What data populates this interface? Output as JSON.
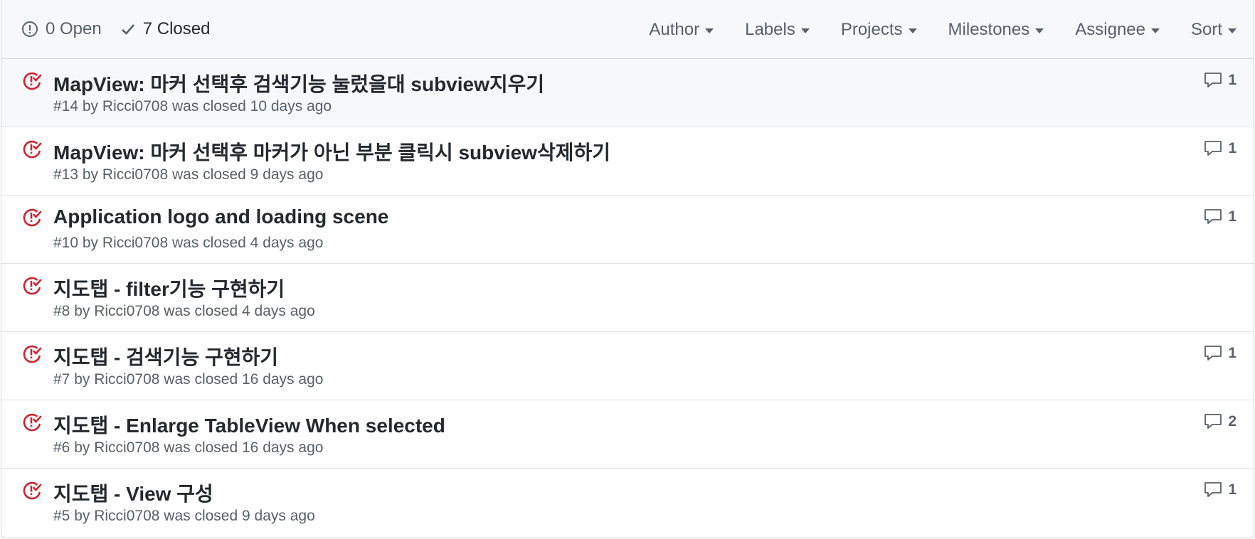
{
  "header": {
    "open_label": "0 Open",
    "closed_label": "7 Closed",
    "filters": [
      "Author",
      "Labels",
      "Projects",
      "Milestones",
      "Assignee",
      "Sort"
    ]
  },
  "colors": {
    "closed_icon": "#cb2431",
    "header_bg": "#f6f8fa",
    "muted_text": "#586069"
  },
  "issues": [
    {
      "title": "MapView: 마커 선택후 검색기능 눌렀을대 subview지우기",
      "number": "#14",
      "author": "Ricci0708",
      "closed_text": "was closed 10 days ago",
      "comments": "1"
    },
    {
      "title": "MapView: 마커 선택후 마커가 아닌 부분 클릭시 subview삭제하기",
      "number": "#13",
      "author": "Ricci0708",
      "closed_text": "was closed 9 days ago",
      "comments": "1"
    },
    {
      "title": "Application logo and loading scene",
      "number": "#10",
      "author": "Ricci0708",
      "closed_text": "was closed 4 days ago",
      "comments": "1"
    },
    {
      "title": "지도탭 - filter기능 구현하기",
      "number": "#8",
      "author": "Ricci0708",
      "closed_text": "was closed 4 days ago",
      "comments": ""
    },
    {
      "title": "지도탭 - 검색기능 구현하기",
      "number": "#7",
      "author": "Ricci0708",
      "closed_text": "was closed 16 days ago",
      "comments": "1"
    },
    {
      "title": "지도탭 - Enlarge TableView When selected",
      "number": "#6",
      "author": "Ricci0708",
      "closed_text": "was closed 16 days ago",
      "comments": "2"
    },
    {
      "title": "지도탭 - View 구성",
      "number": "#5",
      "author": "Ricci0708",
      "closed_text": "was closed 9 days ago",
      "comments": "1"
    }
  ]
}
